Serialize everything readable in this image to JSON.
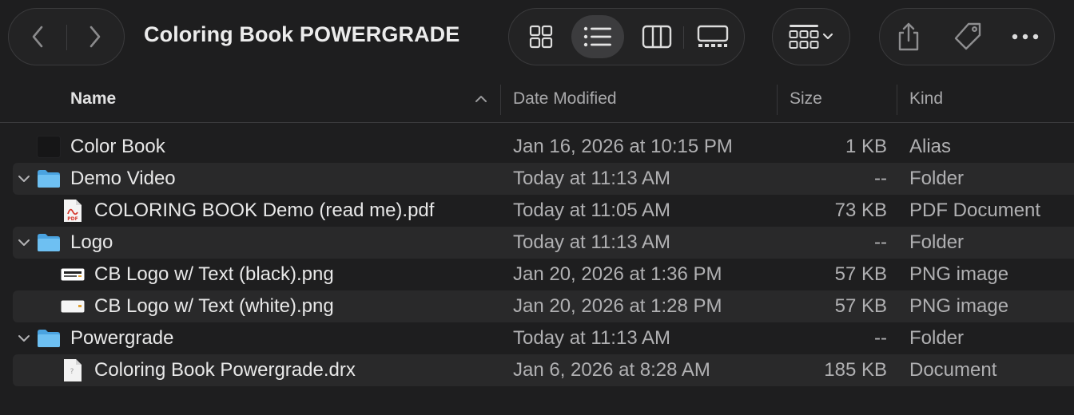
{
  "window": {
    "title": "Coloring Book POWERGRADE"
  },
  "toolbar": {
    "back_icon": "chevron-left-icon",
    "forward_icon": "chevron-right-icon",
    "views": [
      {
        "id": "icons",
        "icon": "grid-icon",
        "active": false
      },
      {
        "id": "list",
        "icon": "list-icon",
        "active": true
      },
      {
        "id": "columns",
        "icon": "columns-icon",
        "active": false
      },
      {
        "id": "gallery",
        "icon": "gallery-icon",
        "active": false
      }
    ],
    "group_icon": "group-by-icon",
    "actions": [
      "share-icon",
      "tag-icon",
      "more-icon"
    ]
  },
  "columns": {
    "name": "Name",
    "date": "Date Modified",
    "size": "Size",
    "kind": "Kind"
  },
  "rows": [
    {
      "name": "Color Book",
      "date": "Jan 16, 2026 at 10:15 PM",
      "size": "1 KB",
      "kind": "Alias",
      "icon": "alias-icon",
      "level": 0,
      "folder": false
    },
    {
      "name": "Demo Video",
      "date": "Today at 11:13 AM",
      "size": "--",
      "kind": "Folder",
      "icon": "folder-icon",
      "level": 0,
      "folder": true,
      "expanded": true
    },
    {
      "name": "COLORING BOOK Demo (read me).pdf",
      "date": "Today at 11:05 AM",
      "size": "73 KB",
      "kind": "PDF Document",
      "icon": "pdf-icon",
      "icon_text": "PDF",
      "level": 1,
      "folder": false
    },
    {
      "name": "Logo",
      "date": "Today at 11:13 AM",
      "size": "--",
      "kind": "Folder",
      "icon": "folder-icon",
      "level": 0,
      "folder": true,
      "expanded": true
    },
    {
      "name": "CB Logo w/ Text (black).png",
      "date": "Jan 20, 2026 at 1:36 PM",
      "size": "57 KB",
      "kind": "PNG image",
      "icon": "image-thumb-black-icon",
      "level": 1,
      "folder": false
    },
    {
      "name": "CB Logo w/ Text (white).png",
      "date": "Jan 20, 2026 at 1:28 PM",
      "size": "57 KB",
      "kind": "PNG image",
      "icon": "image-thumb-white-icon",
      "level": 1,
      "folder": false
    },
    {
      "name": "Powergrade",
      "date": "Today at 11:13 AM",
      "size": "--",
      "kind": "Folder",
      "icon": "folder-icon",
      "level": 0,
      "folder": true,
      "expanded": true
    },
    {
      "name": "Coloring Book Powergrade.drx",
      "date": "Jan 6, 2026 at 8:28 AM",
      "size": "185 KB",
      "kind": "Document",
      "icon": "document-icon",
      "level": 1,
      "folder": false
    }
  ],
  "colors": {
    "background": "#1e1e1f",
    "folder": "#5fb4ea",
    "pdf": "#d63a2f",
    "alt_row": "#29292a"
  }
}
